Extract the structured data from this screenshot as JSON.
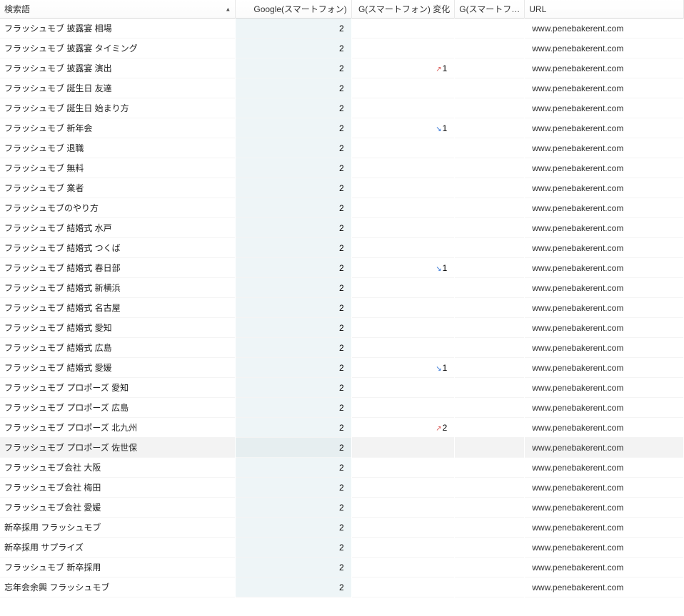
{
  "headers": {
    "keyword": "検索語",
    "google": "Google(スマートフォン)",
    "change": "G(スマートフォン) 変化",
    "g3": "G(スマートフ…",
    "url": "URL"
  },
  "rows": [
    {
      "keyword": "フラッシュモブ 披露宴 相場",
      "google": "2",
      "change_dir": "",
      "change_val": "",
      "url": "www.penebakerent.com",
      "selected": false
    },
    {
      "keyword": "フラッシュモブ 披露宴 タイミング",
      "google": "2",
      "change_dir": "",
      "change_val": "",
      "url": "www.penebakerent.com",
      "selected": false
    },
    {
      "keyword": "フラッシュモブ 披露宴 演出",
      "google": "2",
      "change_dir": "up",
      "change_val": "1",
      "url": "www.penebakerent.com",
      "selected": false
    },
    {
      "keyword": "フラッシュモブ 誕生日 友達",
      "google": "2",
      "change_dir": "",
      "change_val": "",
      "url": "www.penebakerent.com",
      "selected": false
    },
    {
      "keyword": "フラッシュモブ 誕生日 始まり方",
      "google": "2",
      "change_dir": "",
      "change_val": "",
      "url": "www.penebakerent.com",
      "selected": false
    },
    {
      "keyword": "フラッシュモブ 新年会",
      "google": "2",
      "change_dir": "down",
      "change_val": "1",
      "url": "www.penebakerent.com",
      "selected": false
    },
    {
      "keyword": "フラッシュモブ 退職",
      "google": "2",
      "change_dir": "",
      "change_val": "",
      "url": "www.penebakerent.com",
      "selected": false
    },
    {
      "keyword": "フラッシュモブ 無料",
      "google": "2",
      "change_dir": "",
      "change_val": "",
      "url": "www.penebakerent.com",
      "selected": false
    },
    {
      "keyword": "フラッシュモブ 業者",
      "google": "2",
      "change_dir": "",
      "change_val": "",
      "url": "www.penebakerent.com",
      "selected": false
    },
    {
      "keyword": "フラッシュモブのやり方",
      "google": "2",
      "change_dir": "",
      "change_val": "",
      "url": "www.penebakerent.com",
      "selected": false
    },
    {
      "keyword": "フラッシュモブ 結婚式 水戸",
      "google": "2",
      "change_dir": "",
      "change_val": "",
      "url": "www.penebakerent.com",
      "selected": false
    },
    {
      "keyword": "フラッシュモブ 結婚式 つくば",
      "google": "2",
      "change_dir": "",
      "change_val": "",
      "url": "www.penebakerent.com",
      "selected": false
    },
    {
      "keyword": "フラッシュモブ 結婚式 春日部",
      "google": "2",
      "change_dir": "down",
      "change_val": "1",
      "url": "www.penebakerent.com",
      "selected": false
    },
    {
      "keyword": "フラッシュモブ 結婚式 新横浜",
      "google": "2",
      "change_dir": "",
      "change_val": "",
      "url": "www.penebakerent.com",
      "selected": false
    },
    {
      "keyword": "フラッシュモブ 結婚式 名古屋",
      "google": "2",
      "change_dir": "",
      "change_val": "",
      "url": "www.penebakerent.com",
      "selected": false
    },
    {
      "keyword": "フラッシュモブ 結婚式 愛知",
      "google": "2",
      "change_dir": "",
      "change_val": "",
      "url": "www.penebakerent.com",
      "selected": false
    },
    {
      "keyword": "フラッシュモブ 結婚式 広島",
      "google": "2",
      "change_dir": "",
      "change_val": "",
      "url": "www.penebakerent.com",
      "selected": false
    },
    {
      "keyword": "フラッシュモブ 結婚式 愛媛",
      "google": "2",
      "change_dir": "down",
      "change_val": "1",
      "url": "www.penebakerent.com",
      "selected": false
    },
    {
      "keyword": "フラッシュモブ プロポーズ 愛知",
      "google": "2",
      "change_dir": "",
      "change_val": "",
      "url": "www.penebakerent.com",
      "selected": false
    },
    {
      "keyword": "フラッシュモブ プロポーズ 広島",
      "google": "2",
      "change_dir": "",
      "change_val": "",
      "url": "www.penebakerent.com",
      "selected": false
    },
    {
      "keyword": "フラッシュモブ プロポーズ 北九州",
      "google": "2",
      "change_dir": "up",
      "change_val": "2",
      "url": "www.penebakerent.com",
      "selected": false
    },
    {
      "keyword": "フラッシュモブ プロポーズ 佐世保",
      "google": "2",
      "change_dir": "",
      "change_val": "",
      "url": "www.penebakerent.com",
      "selected": true
    },
    {
      "keyword": "フラッシュモブ会社 大阪",
      "google": "2",
      "change_dir": "",
      "change_val": "",
      "url": "www.penebakerent.com",
      "selected": false
    },
    {
      "keyword": "フラッシュモブ会社 梅田",
      "google": "2",
      "change_dir": "",
      "change_val": "",
      "url": "www.penebakerent.com",
      "selected": false
    },
    {
      "keyword": "フラッシュモブ会社 愛媛",
      "google": "2",
      "change_dir": "",
      "change_val": "",
      "url": "www.penebakerent.com",
      "selected": false
    },
    {
      "keyword": "新卒採用 フラッシュモブ",
      "google": "2",
      "change_dir": "",
      "change_val": "",
      "url": "www.penebakerent.com",
      "selected": false
    },
    {
      "keyword": "新卒採用 サプライズ",
      "google": "2",
      "change_dir": "",
      "change_val": "",
      "url": "www.penebakerent.com",
      "selected": false
    },
    {
      "keyword": "フラッシュモブ 新卒採用",
      "google": "2",
      "change_dir": "",
      "change_val": "",
      "url": "www.penebakerent.com",
      "selected": false
    },
    {
      "keyword": "忘年会余興 フラッシュモブ",
      "google": "2",
      "change_dir": "",
      "change_val": "",
      "url": "www.penebakerent.com",
      "selected": false
    }
  ]
}
